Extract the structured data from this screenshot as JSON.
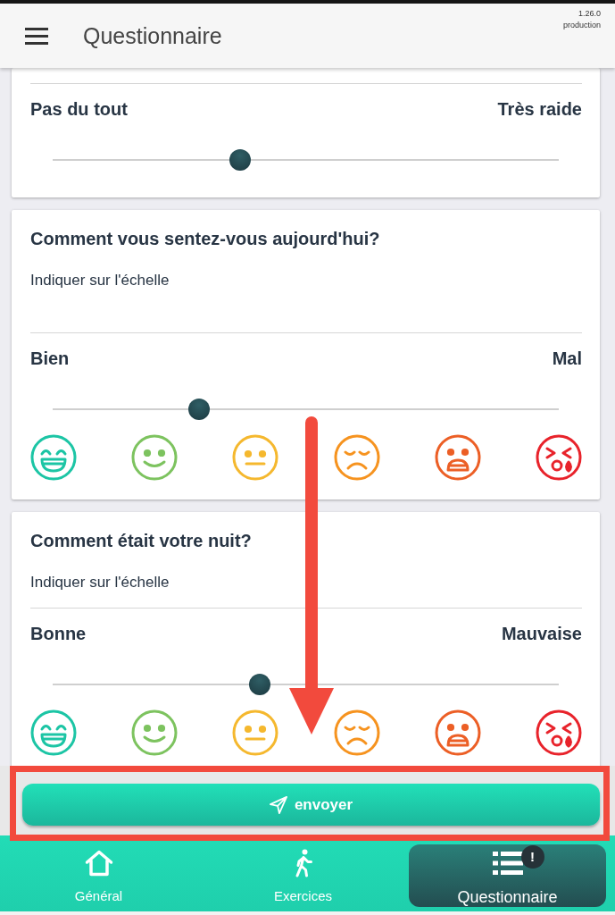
{
  "app_bar": {
    "title": "Questionnaire",
    "version": "1.26.0",
    "environment": "production"
  },
  "questions": [
    {
      "kind": "slider",
      "low_label": "Pas du tout",
      "high_label": "Très raide",
      "level": 0.37
    },
    {
      "kind": "faces",
      "title": "Comment vous sentez-vous aujourd'hui?",
      "hint": "Indiquer sur l'échelle",
      "low_label": "Bien",
      "high_label": "Mal",
      "level": 0.29,
      "faces": [
        {
          "kind": "laughing",
          "color": "#1cc5a5"
        },
        {
          "kind": "smiling",
          "color": "#7dc35f"
        },
        {
          "kind": "neutral",
          "color": "#f5b82e"
        },
        {
          "kind": "sad",
          "color": "#f6931f"
        },
        {
          "kind": "anguished",
          "color": "#ec5f26"
        },
        {
          "kind": "crying",
          "color": "#e8232b"
        }
      ]
    },
    {
      "kind": "faces",
      "title": "Comment était votre nuit?",
      "hint": "Indiquer sur l'échelle",
      "low_label": "Bonne",
      "high_label": "Mauvaise",
      "level": 0.41,
      "faces": [
        {
          "kind": "laughing",
          "color": "#1cc5a5"
        },
        {
          "kind": "smiling",
          "color": "#7dc35f"
        },
        {
          "kind": "neutral",
          "color": "#f5b82e"
        },
        {
          "kind": "sad",
          "color": "#f6931f"
        },
        {
          "kind": "anguished",
          "color": "#ec5f26"
        },
        {
          "kind": "crying",
          "color": "#e8232b"
        }
      ]
    }
  ],
  "submit_button": {
    "label": "envoyer"
  },
  "nav": [
    {
      "kind": "home",
      "label": "Général",
      "selected": false
    },
    {
      "kind": "walk",
      "label": "Exercices",
      "selected": false
    },
    {
      "kind": "list",
      "label": "Questionnaire",
      "selected": true,
      "badge": "!"
    }
  ],
  "annotations": {
    "arrow": true,
    "highlight_frame": true
  }
}
